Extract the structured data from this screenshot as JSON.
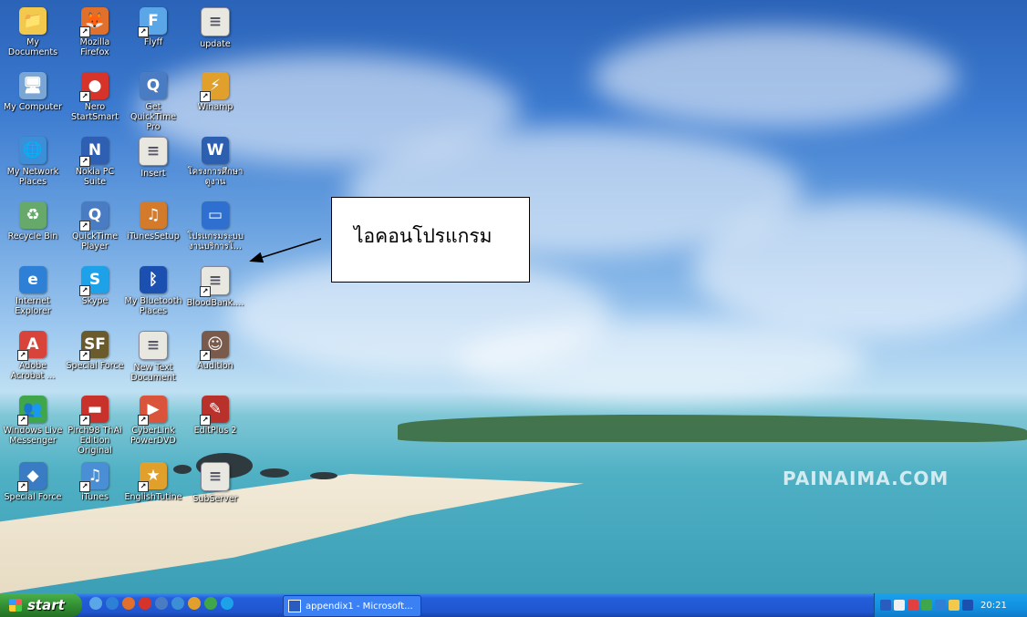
{
  "desktop": {
    "icons": [
      {
        "label": "My Documents",
        "color": "#f2c94c",
        "glyph": "📁",
        "shortcut": false
      },
      {
        "label": "Mozilla Firefox",
        "color": "#e0702b",
        "glyph": "🦊",
        "shortcut": true
      },
      {
        "label": "Flyff",
        "color": "#5aa6e6",
        "glyph": "F",
        "shortcut": true
      },
      {
        "label": "update",
        "color": "#e8e8e0",
        "glyph": "≡",
        "shortcut": false
      },
      {
        "label": "My Computer",
        "color": "#7aa6d6",
        "glyph": "🖥",
        "shortcut": false
      },
      {
        "label": "Nero StartSmart",
        "color": "#d6332b",
        "glyph": "●",
        "shortcut": true
      },
      {
        "label": "Get QuickTime Pro",
        "color": "#4a7cc4",
        "glyph": "Q",
        "shortcut": false
      },
      {
        "label": "Winamp",
        "color": "#e0a02b",
        "glyph": "⚡",
        "shortcut": true
      },
      {
        "label": "My Network Places",
        "color": "#3c8fd6",
        "glyph": "🌐",
        "shortcut": false
      },
      {
        "label": "Nokia PC Suite",
        "color": "#2e5fb3",
        "glyph": "N",
        "shortcut": true
      },
      {
        "label": "Insert",
        "color": "#e8e8e0",
        "glyph": "≡",
        "shortcut": false
      },
      {
        "label": "โครงการศึกษาดูงาน",
        "color": "#2d5fb0",
        "glyph": "W",
        "shortcut": false
      },
      {
        "label": "Recycle Bin",
        "color": "#66a96a",
        "glyph": "♻",
        "shortcut": false
      },
      {
        "label": "QuickTime Player",
        "color": "#4a7cc4",
        "glyph": "Q",
        "shortcut": true
      },
      {
        "label": "iTunesSetup",
        "color": "#d47a2b",
        "glyph": "♫",
        "shortcut": false
      },
      {
        "label": "โปรแกรมระบบงานบริการโ...",
        "color": "#2f6fd0",
        "glyph": "▭",
        "shortcut": false
      },
      {
        "label": "Internet Explorer",
        "color": "#2e7fd6",
        "glyph": "e",
        "shortcut": false
      },
      {
        "label": "Skype",
        "color": "#1da1e8",
        "glyph": "S",
        "shortcut": true
      },
      {
        "label": "My Bluetooth Places",
        "color": "#1b4fb0",
        "glyph": "ᛒ",
        "shortcut": false
      },
      {
        "label": "BloodBank....",
        "color": "#e8e8e0",
        "glyph": "≡",
        "shortcut": true
      },
      {
        "label": "Adobe Acrobat ...",
        "color": "#d9443a",
        "glyph": "A",
        "shortcut": true
      },
      {
        "label": "Special Force",
        "color": "#6b5a2b",
        "glyph": "SF",
        "shortcut": true
      },
      {
        "label": "New Text Document",
        "color": "#e8e8e0",
        "glyph": "≡",
        "shortcut": false
      },
      {
        "label": "Audition",
        "color": "#7a5a4a",
        "glyph": "☺",
        "shortcut": true
      },
      {
        "label": "Windows Live Messenger",
        "color": "#3fa64a",
        "glyph": "👥",
        "shortcut": true
      },
      {
        "label": "Pirch98 ThAi Edition Original",
        "color": "#c8322b",
        "glyph": "▬",
        "shortcut": true
      },
      {
        "label": "CyberLink PowerDVD",
        "color": "#d9543a",
        "glyph": "▶",
        "shortcut": true
      },
      {
        "label": "EditPlus 2",
        "color": "#b8322b",
        "glyph": "✎",
        "shortcut": true
      },
      {
        "label": "Special Force",
        "color": "#3a7cc4",
        "glyph": "◆",
        "shortcut": true
      },
      {
        "label": "iTunes",
        "color": "#4a8fd6",
        "glyph": "♫",
        "shortcut": true
      },
      {
        "label": "EnglishTutine",
        "color": "#e0a02b",
        "glyph": "★",
        "shortcut": true
      },
      {
        "label": "SubServer",
        "color": "#e8e8e0",
        "glyph": "≡",
        "shortcut": false
      }
    ],
    "callout_text": "ไอคอนโปรแกรม",
    "watermark": "PAINAIMA.COM"
  },
  "taskbar": {
    "start_label": "start",
    "quick_launch_colors": [
      "#5aa6e6",
      "#2e7fd6",
      "#e0702b",
      "#d6332b",
      "#4a7cc4",
      "#3c8fd6",
      "#e0a02b",
      "#3fa64a",
      "#1da1e8"
    ],
    "task_label": "appendix1 - Microsoft...",
    "tray_colors": [
      "#2a5cc0",
      "#f0f0f0",
      "#e04040",
      "#3fa64a",
      "#2e7fd6",
      "#f2c94c",
      "#1b4fb0"
    ],
    "clock": "20:21"
  }
}
